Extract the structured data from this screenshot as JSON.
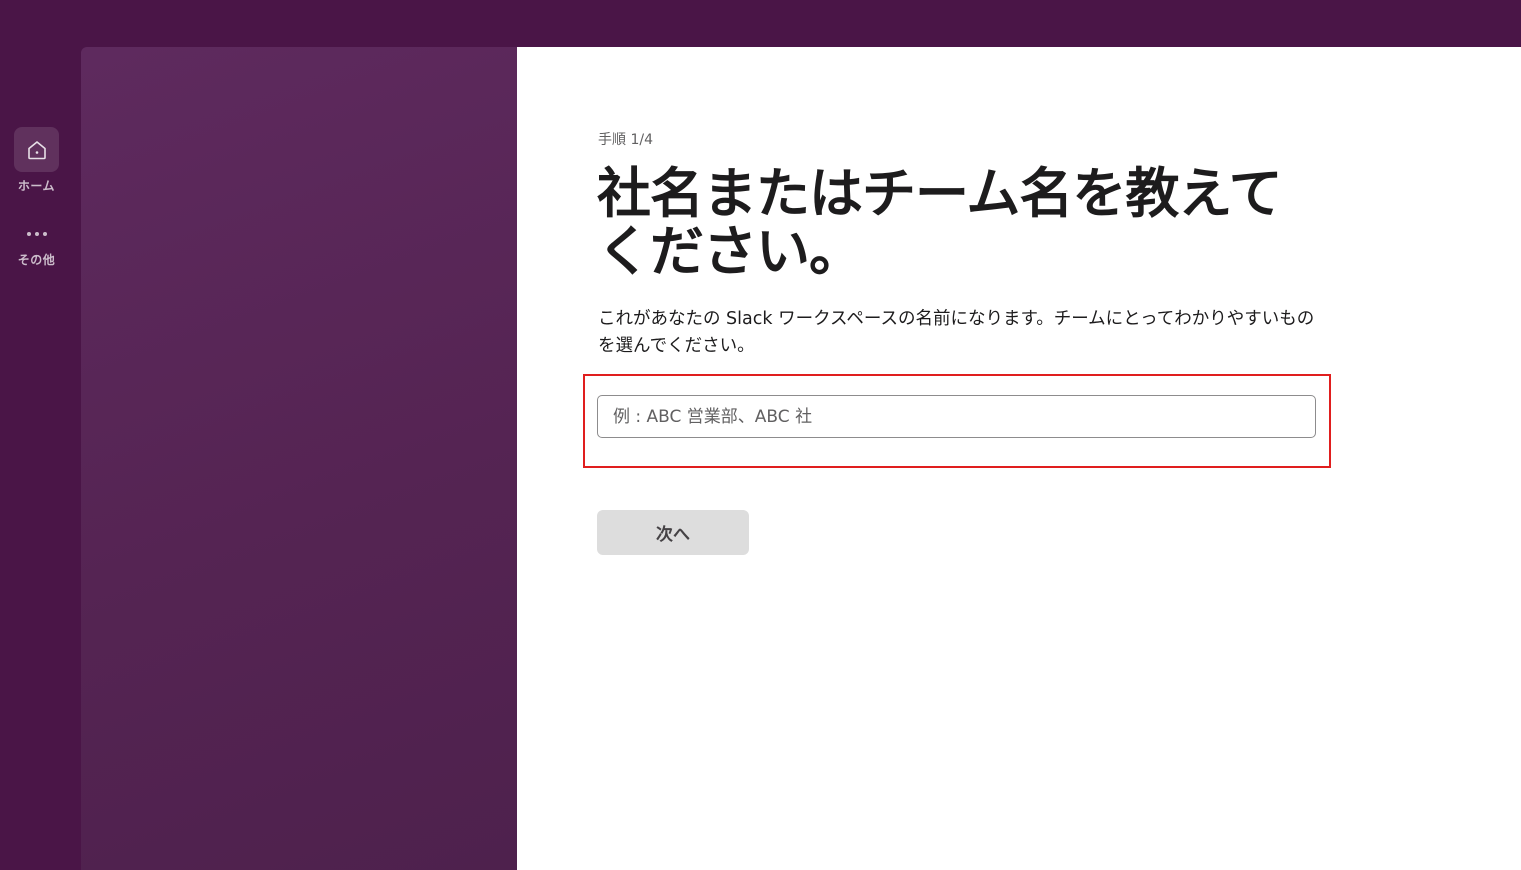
{
  "rail": {
    "home_label": "ホーム",
    "more_label": "その他"
  },
  "setup": {
    "step": "手順 1/4",
    "headline": "社名またはチーム名を教えてください。",
    "description": "これがあなたの Slack ワークスペースの名前になります。チームにとってわかりやすいものを選んでください。",
    "input_value": "",
    "input_placeholder": "例 : ABC 営業部、ABC 社",
    "next_label": "次へ"
  },
  "icons": {
    "home": "home-icon",
    "more": "more-dots-icon"
  },
  "colors": {
    "aubergine": "#4a1547",
    "highlight_border": "#e01e1e",
    "button_disabled": "#dddddd"
  }
}
